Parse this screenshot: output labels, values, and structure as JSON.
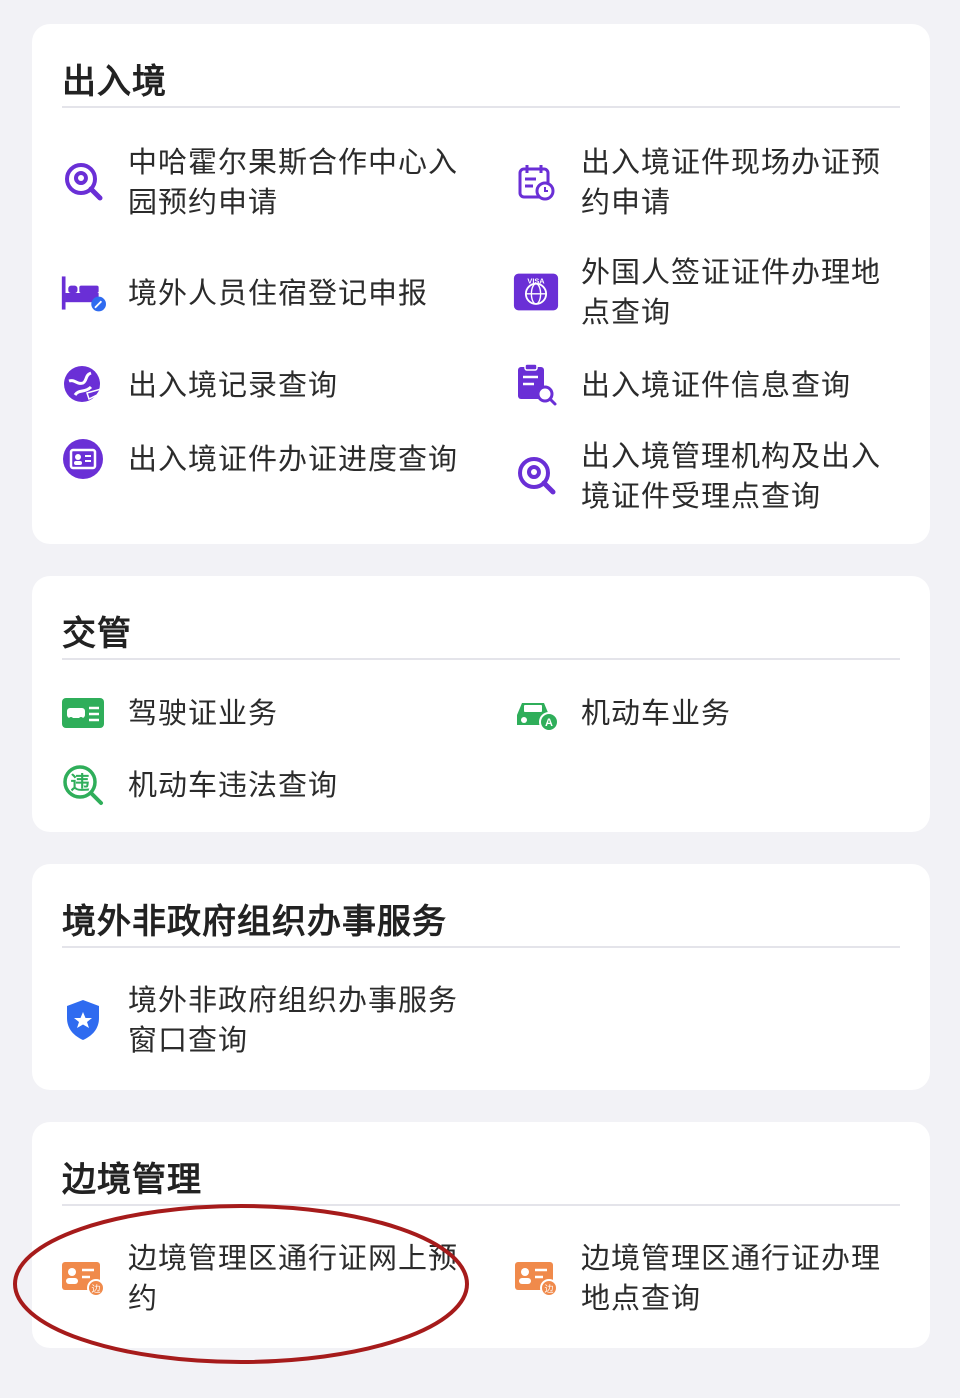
{
  "sections": [
    {
      "title": "出入境",
      "items": [
        {
          "label": "中哈霍尔果斯合作中心入园预约申请",
          "icon": "location-search-icon"
        },
        {
          "label": "出入境证件现场办证预约申请",
          "icon": "calendar-clock-icon"
        },
        {
          "label": "境外人员住宿登记申报",
          "icon": "bed-edit-icon"
        },
        {
          "label": "外国人签证证件办理地点查询",
          "icon": "visa-card-icon"
        },
        {
          "label": "出入境记录查询",
          "icon": "globe-plane-icon"
        },
        {
          "label": "出入境证件信息查询",
          "icon": "document-search-icon"
        },
        {
          "label": "出入境证件办证进度查询",
          "icon": "id-card-circle-icon"
        },
        {
          "label": "出入境管理机构及出入境证件受理点查询",
          "icon": "location-search-icon"
        }
      ]
    },
    {
      "title": "交管",
      "items": [
        {
          "label": "驾驶证业务",
          "icon": "driver-license-icon"
        },
        {
          "label": "机动车业务",
          "icon": "car-icon"
        },
        {
          "label": "机动车违法查询",
          "icon": "violation-search-icon"
        }
      ]
    },
    {
      "title": "境外非政府组织办事服务",
      "items": [
        {
          "label": "境外非政府组织办事服务窗口查询",
          "icon": "police-shield-icon"
        }
      ]
    },
    {
      "title": "边境管理",
      "items": [
        {
          "label": "边境管理区通行证网上预约",
          "icon": "border-pass-icon"
        },
        {
          "label": "边境管理区通行证办理地点查询",
          "icon": "border-pass-icon"
        }
      ]
    }
  ],
  "colors": {
    "purple": "#6a2fd6",
    "green": "#2fae5a",
    "blue": "#2f6bf0",
    "orange": "#f08a4b",
    "annotation_red": "#a61b1b"
  },
  "icon_text": {
    "visa": "VISA",
    "violation": "违",
    "car_badge": "A",
    "border_badge": "边"
  }
}
